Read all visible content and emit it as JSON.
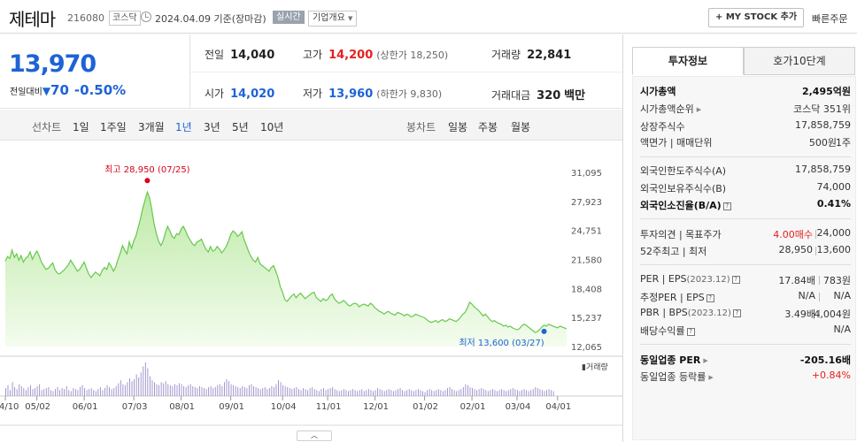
{
  "header": {
    "name": "제테마",
    "code": "216080",
    "market": "코스닥",
    "date": "2024.04.09",
    "date_suffix": "기준(장마감)",
    "realtime": "실시간",
    "overview": "기업개요",
    "mystock_label": "+ MY STOCK 추가",
    "quick_order": "빠른주문"
  },
  "price": {
    "current": "13,970",
    "change_label": "전일대비",
    "change_arrow": "▼",
    "change_value": "70",
    "change_pct": "-0.50%"
  },
  "quotes": {
    "prev_label": "전일",
    "prev": "14,040",
    "high_label": "고가",
    "high": "14,200",
    "upper_limit": "(상한가 18,250)",
    "volume_label": "거래량",
    "volume": "22,841",
    "open_label": "시가",
    "open": "14,020",
    "low_label": "저가",
    "low": "13,960",
    "lower_limit": "(하한가 9,830)",
    "amount_label": "거래대금",
    "amount": "320",
    "amount_unit": "백만"
  },
  "period_bar": {
    "line_label": "선차트",
    "line_items": [
      "1일",
      "1주일",
      "3개월",
      "1년",
      "3년",
      "5년",
      "10년"
    ],
    "selected": "1년",
    "candle_label": "봉차트",
    "candle_items": [
      "일봉",
      "주봉",
      "월봉"
    ]
  },
  "chart_data": {
    "type": "area",
    "y_ticks": [
      "31,095",
      "27,923",
      "24,751",
      "21,580",
      "18,408",
      "15,237",
      "12,065"
    ],
    "ylim": [
      12065,
      31095
    ],
    "x_ticks": [
      "04/10",
      "05/02",
      "06/01",
      "07/03",
      "08/01",
      "09/01",
      "10/04",
      "11/01",
      "12/01",
      "01/02",
      "02/01",
      "03/04",
      "04/01"
    ],
    "x_tick_index": [
      0,
      14,
      35,
      57,
      78,
      100,
      123,
      143,
      164,
      186,
      207,
      227,
      245
    ],
    "series": [
      {
        "values": [
          21400,
          21900,
          21700,
          22600,
          21800,
          22200,
          21500,
          22000,
          21300,
          21700,
          21900,
          22400,
          21600,
          22100,
          22500,
          22000,
          21300,
          20900,
          20500,
          20600,
          20900,
          21200,
          20500,
          20100,
          20000,
          20200,
          20400,
          20700,
          21000,
          21500,
          21100,
          20700,
          20300,
          20500,
          20900,
          21300,
          20600,
          20000,
          19600,
          19900,
          20200,
          20000,
          19800,
          20400,
          20700,
          20500,
          21200,
          20800,
          20300,
          20800,
          21600,
          22300,
          23100,
          22600,
          22200,
          23500,
          22800,
          23600,
          24200,
          25100,
          26100,
          27200,
          28100,
          28950,
          28300,
          27000,
          25500,
          24400,
          23600,
          23100,
          23600,
          24500,
          25200,
          24700,
          24100,
          23900,
          24400,
          24300,
          24900,
          25200,
          24700,
          24100,
          23700,
          23300,
          23100,
          23500,
          23600,
          23800,
          23200,
          22700,
          22400,
          23000,
          22500,
          22600,
          23000,
          22700,
          22300,
          22600,
          23000,
          23600,
          24300,
          24700,
          24500,
          24100,
          24300,
          24600,
          23700,
          23100,
          22400,
          21900,
          21500,
          21300,
          21800,
          21100,
          20900,
          20700,
          20500,
          20300,
          20700,
          20900,
          20300,
          19600,
          18600,
          18000,
          17200,
          17000,
          17300,
          17600,
          17800,
          17400,
          17700,
          17900,
          17600,
          17300,
          17500,
          17700,
          17900,
          18000,
          17400,
          17200,
          17000,
          17300,
          17100,
          17200,
          17600,
          17800,
          17300,
          17000,
          16800,
          16900,
          17100,
          16900,
          16600,
          16500,
          16700,
          16800,
          16700,
          16400,
          16600,
          16700,
          16600,
          16500,
          16800,
          16600,
          16300,
          16100,
          15900,
          15800,
          15600,
          15800,
          15900,
          15700,
          15600,
          15500,
          15800,
          15700,
          15600,
          15400,
          15600,
          15500,
          15300,
          15400,
          15600,
          15500,
          15400,
          15300,
          15200,
          15000,
          14800,
          14700,
          14800,
          14900,
          14700,
          14900,
          15000,
          14800,
          14900,
          15100,
          15000,
          14900,
          14800,
          15000,
          15300,
          15600,
          15800,
          16300,
          16900,
          16700,
          16400,
          16200,
          16000,
          15700,
          15400,
          15600,
          15300,
          15000,
          14800,
          14900,
          14700,
          14600,
          14500,
          14300,
          14400,
          14200,
          14300,
          14100,
          14000,
          13900,
          14000,
          14300,
          14500,
          14400,
          14200,
          14000,
          13800,
          13600,
          13700,
          13900,
          14200,
          14400,
          14300,
          14500,
          14400,
          14300,
          14200,
          14100,
          14300,
          14200,
          14100,
          14000
        ]
      }
    ],
    "volume": [
      40,
      55,
      30,
      70,
      45,
      35,
      60,
      50,
      40,
      30,
      45,
      55,
      35,
      40,
      50,
      60,
      30,
      35,
      40,
      45,
      30,
      25,
      35,
      45,
      30,
      40,
      35,
      50,
      30,
      25,
      40,
      35,
      30,
      45,
      55,
      40,
      30,
      35,
      40,
      30,
      25,
      35,
      45,
      30,
      40,
      55,
      45,
      35,
      40,
      50,
      65,
      80,
      60,
      55,
      70,
      90,
      75,
      85,
      110,
      95,
      120,
      150,
      170,
      140,
      100,
      80,
      70,
      60,
      55,
      70,
      65,
      75,
      60,
      55,
      50,
      60,
      55,
      65,
      60,
      50,
      45,
      55,
      60,
      50,
      45,
      40,
      50,
      45,
      40,
      35,
      45,
      50,
      40,
      45,
      55,
      60,
      50,
      70,
      85,
      75,
      60,
      55,
      50,
      45,
      40,
      50,
      45,
      40,
      55,
      60,
      50,
      45,
      40,
      35,
      40,
      45,
      35,
      40,
      50,
      45,
      60,
      80,
      70,
      55,
      50,
      45,
      40,
      35,
      40,
      45,
      35,
      30,
      40,
      35,
      30,
      40,
      45,
      35,
      30,
      25,
      35,
      40,
      30,
      35,
      40,
      45,
      35,
      30,
      25,
      30,
      35,
      30,
      25,
      30,
      35,
      30,
      25,
      30,
      35,
      25,
      30,
      35,
      30,
      25,
      30,
      40,
      35,
      30,
      25,
      30,
      35,
      30,
      25,
      30,
      35,
      40,
      30,
      25,
      30,
      35,
      30,
      25,
      30,
      35,
      30,
      25,
      20,
      30,
      35,
      30,
      25,
      30,
      35,
      30,
      25,
      30,
      40,
      45,
      35,
      30,
      25,
      30,
      35,
      45,
      60,
      55,
      45,
      40,
      35,
      30,
      35,
      40,
      35,
      30,
      25,
      30,
      35,
      30,
      25,
      30,
      35,
      30,
      25,
      30,
      35,
      40,
      35,
      30,
      25,
      30,
      35,
      30,
      25,
      30,
      35,
      45,
      40,
      35,
      30,
      25,
      30,
      35,
      30,
      25
    ],
    "volume_label": "거래량",
    "high_label": "최고 28,950 (07/25)",
    "high_index": 63,
    "low_label": "최저 13,600 (03/27)",
    "low_index": 239,
    "colors": {
      "line": "#67c84b",
      "fill_top": "#bdeaa7",
      "fill_bottom": "#f4fcef",
      "volume": "#9b8bc8",
      "high": "#d9001b",
      "low": "#1d63d6"
    }
  },
  "tabs": {
    "active": "투자정보",
    "inactive": "호가10단계"
  },
  "invest": {
    "mcap_label": "시가총액",
    "mcap": "2,495억원",
    "mcap_rank_label": "시가총액순위",
    "mcap_rank": "코스닥 351위",
    "shares_label": "상장주식수",
    "shares": "17,858,759",
    "par_label": "액면가 | 매매단위",
    "par": "500원",
    "unit": "1주",
    "foreign_limit_label": "외국인한도주식수(A)",
    "foreign_limit": "17,858,759",
    "foreign_hold_label": "외국인보유주식수(B)",
    "foreign_hold": "74,000",
    "foreign_ratio_label": "외국인소진율(B/A)",
    "foreign_ratio": "0.41%",
    "opinion_label": "투자의견 | 목표주가",
    "opinion": "4.00매수",
    "target": "24,000",
    "w52_label": "52주최고 | 최저",
    "w52_high": "28,950",
    "w52_low": "13,600",
    "per_label": "PER | EPS",
    "per_date": "(2023.12)",
    "per": "17.84배",
    "eps": "783원",
    "est_label": "추정PER | EPS",
    "est_per": "N/A",
    "est_eps": "N/A",
    "pbr_label": "PBR | BPS",
    "pbr_date": "(2023.12)",
    "pbr": "3.49배",
    "bps": "4,004원",
    "div_label": "배당수익률",
    "div": "N/A",
    "ind_per_label": "동일업종 PER",
    "ind_per": "-205.16배",
    "ind_chg_label": "동일업종 등락률",
    "ind_chg": "+0.84%"
  },
  "fold_label": "︿"
}
